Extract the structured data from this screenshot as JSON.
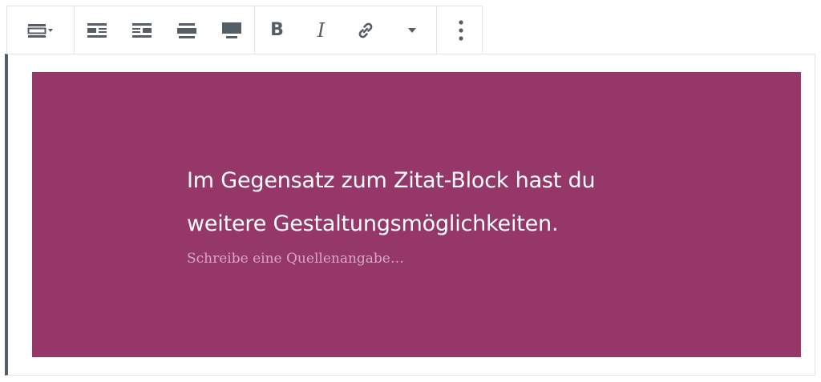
{
  "toolbar": {
    "switcher_icon": "block-style-switcher-icon",
    "align_icons": [
      "align-left-icon",
      "align-right-icon",
      "align-wide-icon",
      "align-full-icon"
    ],
    "format": {
      "bold_label": "B",
      "italic_label": "I",
      "link_icon": "link-icon",
      "more_formats_icon": "chevron-down-icon"
    },
    "more_options_icon": "vertical-ellipsis-icon"
  },
  "pullquote": {
    "quote_line1": "Im Gegensatz zum Zitat-Block hast du",
    "quote_line2": "weitere Gestaltungsmöglichkeiten.",
    "citation_placeholder": "Schreibe eine Quellenangabe…",
    "background_color": "#96376a",
    "text_color": "#ffffff"
  },
  "colors": {
    "toolbar_icon": "#555d66",
    "border": "#e2e4e7",
    "selected_block_indicator": "#555d66"
  }
}
